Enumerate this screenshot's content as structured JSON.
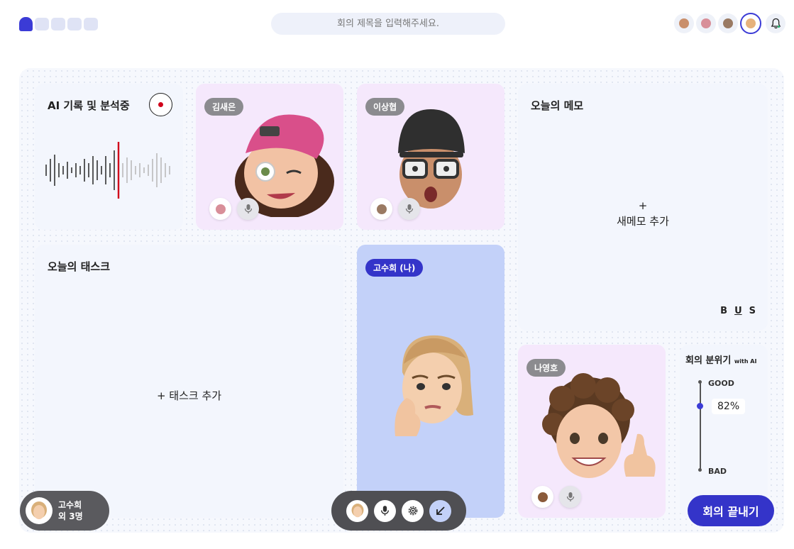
{
  "header": {
    "search_placeholder": "회의 제목을 입력해주세요."
  },
  "ai_card": {
    "title": "AI 기록 및 분석중"
  },
  "participants_cards": [
    {
      "name": "김새은"
    },
    {
      "name": "이상협"
    },
    {
      "name": "고수희 (나)"
    },
    {
      "name": "나영호"
    }
  ],
  "memo": {
    "title": "오늘의 메모",
    "add_plus": "+",
    "add_label": "새메모 추가",
    "bold": "B",
    "underline": "U",
    "strike": "S"
  },
  "tasks": {
    "title": "오늘의 태스크",
    "add_label": "+ 태스크 추가"
  },
  "mood": {
    "title": "회의 분위기",
    "title_suffix": "with AI",
    "good": "GOOD",
    "bad": "BAD",
    "value": "82%",
    "level": 0.82
  },
  "footer": {
    "participants_line1": "고수희",
    "participants_line2": "외 3명",
    "end_label": "회의 끝내기"
  },
  "colors": {
    "accent": "#3b3bd6",
    "record": "#d0021b",
    "card_pink": "#f5e8fc",
    "card_blue": "#c3d1f9",
    "card_light": "#f3f6fd"
  },
  "icons": [
    "mic-icon",
    "settings-gear-icon",
    "minimize-arrow-icon",
    "bell-icon",
    "record-dot-icon"
  ]
}
